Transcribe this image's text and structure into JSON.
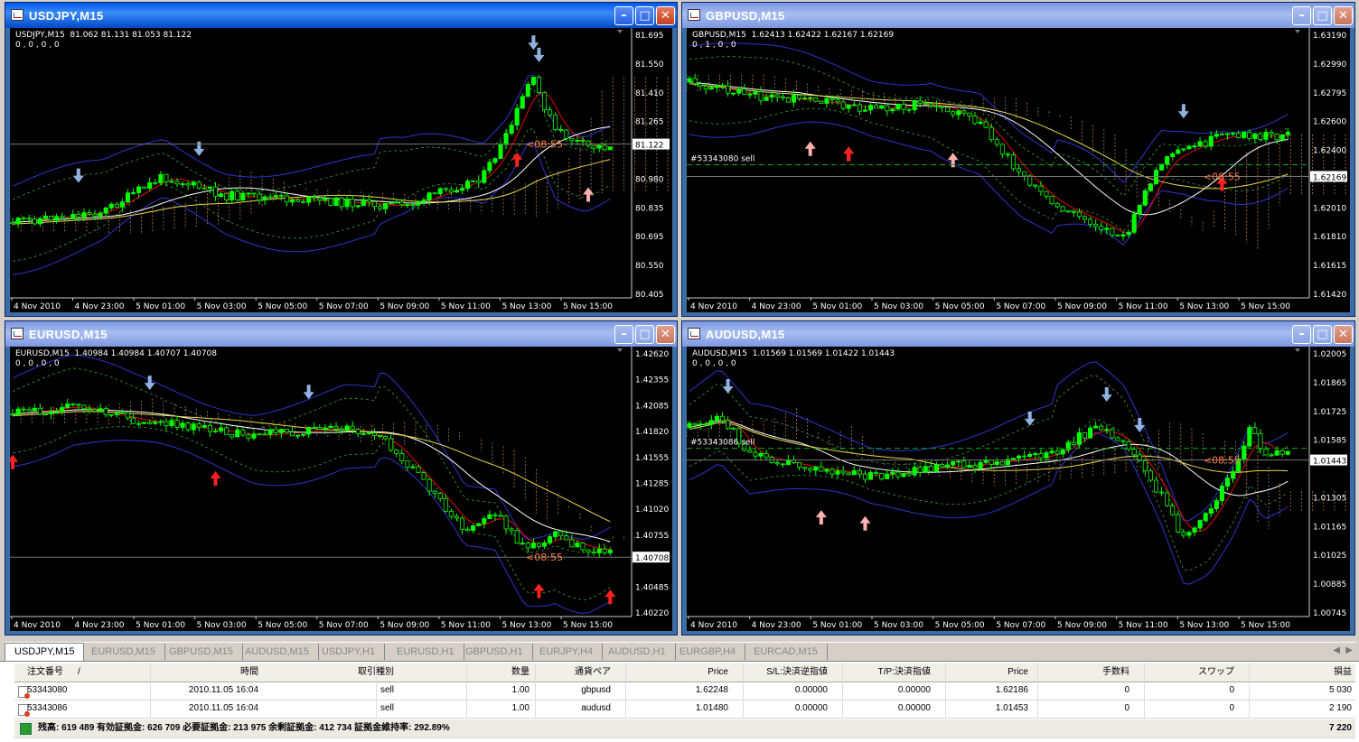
{
  "charts": [
    {
      "title": "USDJPY,M15",
      "header": "USDJPY,M15  81.062 81.131 81.053 81.122",
      "sub": "0 , 0 , 0 , 0",
      "prices": [
        "81.695",
        "81.550",
        "81.410",
        "81.265",
        "81.122",
        "80.980",
        "80.835",
        "80.695",
        "80.550",
        "80.405"
      ],
      "current": "81.122",
      "timer": "08:55",
      "order_label": "",
      "times": [
        "4 Nov 2010",
        "4 Nov 23:00",
        "5 Nov 01:00",
        "5 Nov 03:00",
        "5 Nov 05:00",
        "5 Nov 07:00",
        "5 Nov 09:00",
        "5 Nov 11:00",
        "5 Nov 13:00",
        "5 Nov 15:00"
      ]
    },
    {
      "title": "GBPUSD,M15",
      "header": "GBPUSD,M15  1.62413 1.62422 1.62167 1.62169",
      "sub": "0 , 1 , 0 , 0",
      "prices": [
        "1.63190",
        "1.62990",
        "1.62795",
        "1.62600",
        "1.62400",
        "1.62169",
        "1.62010",
        "1.61810",
        "1.61615",
        "1.61420"
      ],
      "current": "1.62169",
      "timer": "08:55",
      "order_label": "#53343080 sell",
      "times": [
        "4 Nov 2010",
        "4 Nov 23:00",
        "5 Nov 01:00",
        "5 Nov 03:00",
        "5 Nov 05:00",
        "5 Nov 07:00",
        "5 Nov 09:00",
        "5 Nov 11:00",
        "5 Nov 13:00",
        "5 Nov 15:00"
      ]
    },
    {
      "title": "EURUSD,M15",
      "header": "EURUSD,M15  1.40984 1.40984 1.40707 1.40708",
      "sub": "0 , 0 , 0 , 0",
      "prices": [
        "1.42620",
        "1.42355",
        "1.42085",
        "1.41820",
        "1.41555",
        "1.41285",
        "1.41020",
        "1.40755",
        "1.40708",
        "1.40485",
        "1.40220"
      ],
      "current": "1.40708",
      "timer": "08:55",
      "order_label": "",
      "times": [
        "4 Nov 2010",
        "4 Nov 23:00",
        "5 Nov 01:00",
        "5 Nov 03:00",
        "5 Nov 05:00",
        "5 Nov 07:00",
        "5 Nov 09:00",
        "5 Nov 11:00",
        "5 Nov 13:00",
        "5 Nov 15:00"
      ]
    },
    {
      "title": "AUDUSD,M15",
      "header": "AUDUSD,M15  1.01569 1.01569 1.01422 1.01443",
      "sub": "0 , 0 , 0 , 0",
      "prices": [
        "1.02005",
        "1.01865",
        "1.01725",
        "1.01585",
        "1.01443",
        "1.01305",
        "1.01165",
        "1.01025",
        "1.00885",
        "1.00745"
      ],
      "current": "1.01443",
      "timer": "08:55",
      "order_label": "#53343086 sell",
      "times": [
        "4 Nov 2010",
        "4 Nov 23:00",
        "5 Nov 01:00",
        "5 Nov 03:00",
        "5 Nov 05:00",
        "5 Nov 07:00",
        "5 Nov 09:00",
        "5 Nov 11:00",
        "5 Nov 13:00",
        "5 Nov 15:00"
      ]
    }
  ],
  "tabs": [
    "USDJPY,M15",
    "EURUSD,M15",
    "GBPUSD,M15",
    "AUDUSD,M15",
    "USDJPY,H1",
    "EURUSD,H1",
    "GBPUSD,H1",
    "EURJPY,H4",
    "AUDUSD,H1",
    "EURGBP,H4",
    "EURCAD,M15"
  ],
  "terminal": {
    "headers": [
      "注文番号",
      "/",
      "時間",
      "取引種別",
      "数量",
      "通貨ペア",
      "Price",
      "S/L:決済逆指値",
      "T/P:決済指値",
      "Price",
      "手数料",
      "スワップ",
      "損益"
    ],
    "orders": [
      [
        "53343080",
        "",
        "2010.11.05 16:04",
        "sell",
        "1.00",
        "gbpusd",
        "1.62248",
        "0.00000",
        "0.00000",
        "1.62186",
        "0",
        "0",
        "5 030"
      ],
      [
        "53343086",
        "",
        "2010.11.05 16:04",
        "sell",
        "1.00",
        "audusd",
        "1.01480",
        "0.00000",
        "0.00000",
        "1.01453",
        "0",
        "0",
        "2 190"
      ]
    ],
    "summary": "残高: 619 489  有効証拠金: 626 709  必要証拠金: 213 975  余剰証拠金: 412 734  証拠金維持率: 292.89%",
    "total": "7 220"
  },
  "colors": {
    "bull": "#00ff00",
    "bear": "#ffffff",
    "band": "#3333cc",
    "sar_up": "#ff0000",
    "mid": "#aaaaaa"
  }
}
